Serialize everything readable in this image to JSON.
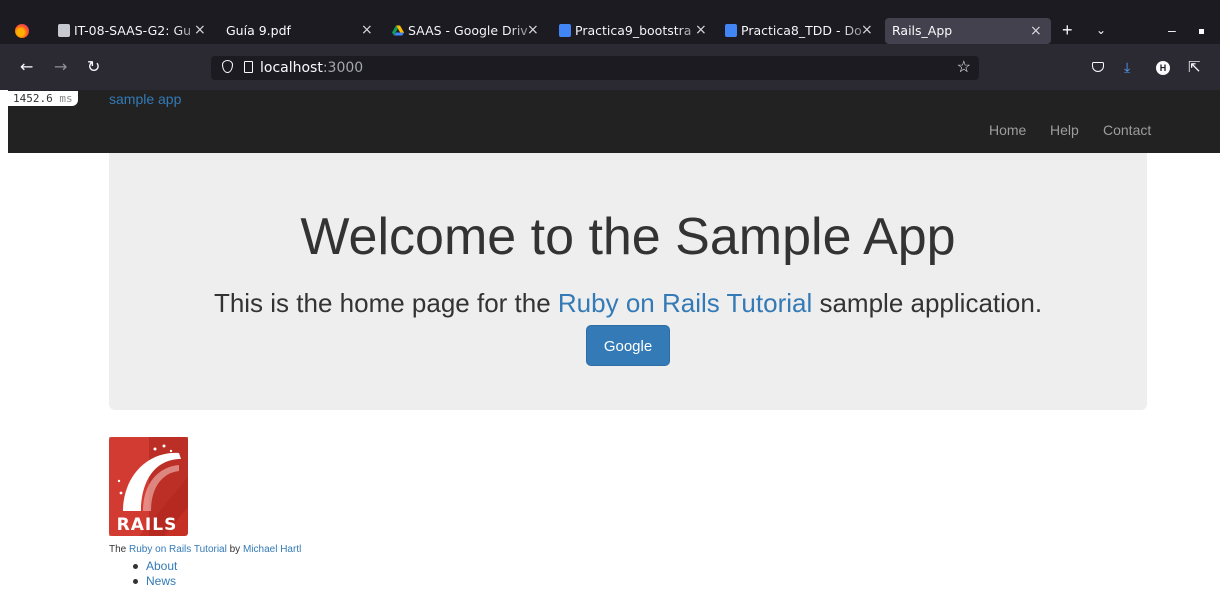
{
  "browser": {
    "tabs": [
      {
        "title": "IT-08-SAAS-G2: Gu",
        "close": "×"
      },
      {
        "title": "Guía 9.pdf",
        "close": "×"
      },
      {
        "title": "SAAS - Google Driv",
        "close": "×"
      },
      {
        "title": "Practica9_bootstra",
        "close": "×"
      },
      {
        "title": "Practica8_TDD - Do",
        "close": "×"
      },
      {
        "title": "Rails_App",
        "close": "×",
        "active": true
      }
    ],
    "new_tab": "+",
    "list_all_tabs": "⌄",
    "minimize": "–",
    "url": {
      "host": "localhost",
      "port": ":3000"
    },
    "icons": {
      "back": "←",
      "forward": "→",
      "reload": "↻",
      "bookmark": "☆",
      "download": "⤓",
      "account": "H",
      "extensions": "⇱"
    }
  },
  "perf_badge": {
    "value": "1452.6",
    "unit": "ms"
  },
  "site": {
    "logo": "sample app",
    "nav": [
      "Home",
      "Help",
      "Contact"
    ]
  },
  "hero": {
    "title": "Welcome to the Sample App",
    "subtitle_before": "This is the home page for the ",
    "subtitle_link": "Ruby on Rails Tutorial",
    "subtitle_after": " sample application.",
    "button": "Google"
  },
  "footer": {
    "logo_text": "RAILS",
    "prefix": "The ",
    "tutorial_link": "Ruby on Rails Tutorial",
    "by": " by ",
    "author_link": "Michael Hartl",
    "links": [
      "About",
      "News"
    ]
  },
  "colors": {
    "link": "#337ab7",
    "header_bg": "#222222",
    "jumbotron_bg": "#eeeeee",
    "rails_red": "#c52f24"
  }
}
